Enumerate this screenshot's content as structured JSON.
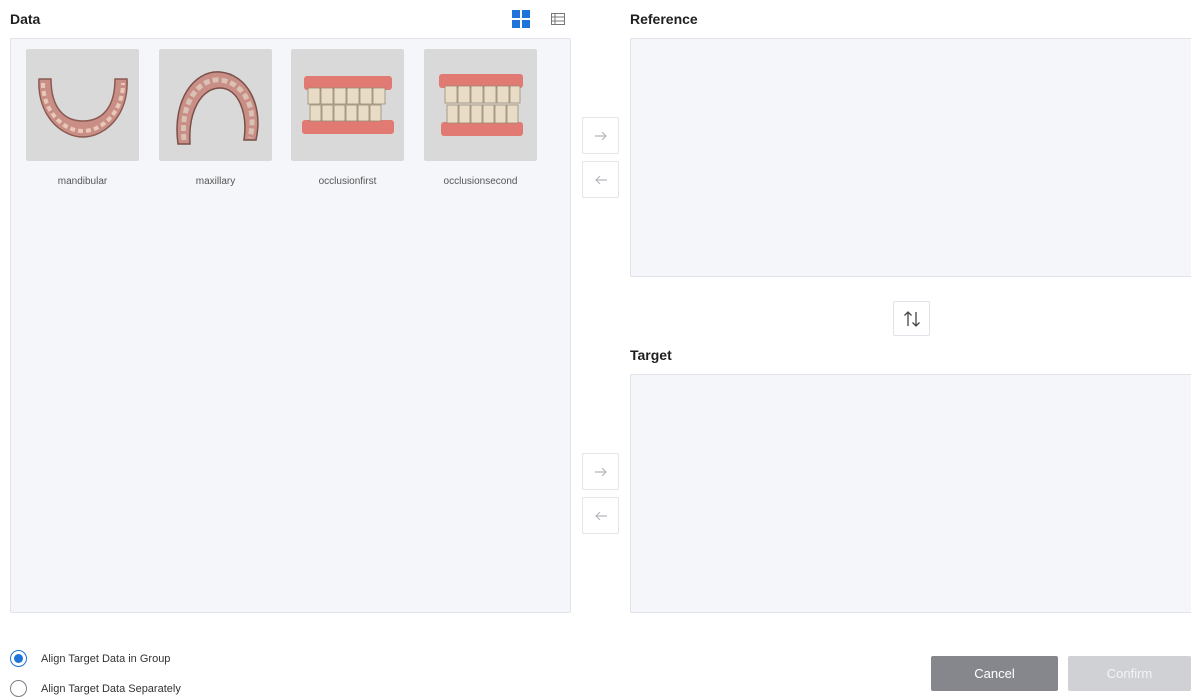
{
  "data_section": {
    "title": "Data",
    "items": [
      {
        "label": "mandibular",
        "icon": "mandibular-arch-icon"
      },
      {
        "label": "maxillary",
        "icon": "maxillary-arch-icon"
      },
      {
        "label": "occlusionfirst",
        "icon": "occlusion-icon"
      },
      {
        "label": "occlusionsecond",
        "icon": "occlusion-icon"
      }
    ]
  },
  "view_toggles": {
    "grid": "grid-view-icon",
    "list": "list-view-icon",
    "active": "grid"
  },
  "reference_section": {
    "title": "Reference"
  },
  "target_section": {
    "title": "Target"
  },
  "options": {
    "align_group": {
      "label": "Align Target Data in Group",
      "checked": true
    },
    "align_separate": {
      "label": "Align Target Data Separately",
      "checked": false
    }
  },
  "buttons": {
    "cancel": "Cancel",
    "confirm": "Confirm"
  },
  "colors": {
    "accent": "#1e74d8",
    "panel_bg": "#f4f6fa",
    "cancel_bg": "#85878c",
    "confirm_disabled_bg": "#cfd1d5"
  }
}
